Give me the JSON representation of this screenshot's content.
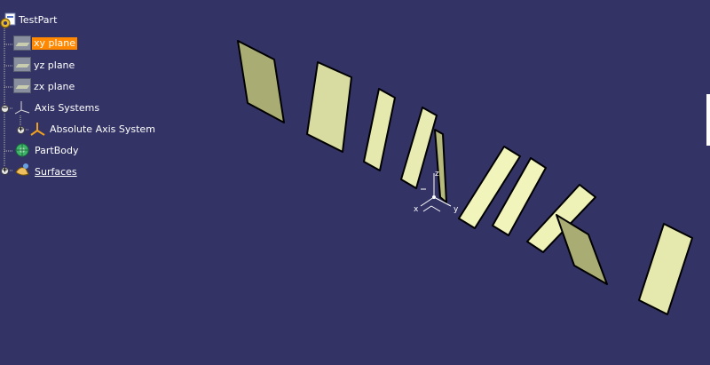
{
  "tree": {
    "root": {
      "label": "TestPart",
      "icon": "part-document-icon"
    },
    "items": [
      {
        "label": "xy plane",
        "icon": "plane-icon",
        "selected": true
      },
      {
        "label": "yz plane",
        "icon": "plane-icon",
        "selected": false
      },
      {
        "label": "zx plane",
        "icon": "plane-icon",
        "selected": false
      },
      {
        "label": "Axis Systems",
        "icon": "axis-systems-icon",
        "expander": "−"
      },
      {
        "label": "Absolute Axis System",
        "icon": "axis-system-icon",
        "expander": "+"
      },
      {
        "label": "PartBody",
        "icon": "part-body-icon"
      },
      {
        "label": "Surfaces",
        "icon": "surfaces-icon",
        "expander": "+"
      }
    ]
  },
  "compass": {
    "x_label": "x",
    "y_label": "y",
    "z_label": "z"
  },
  "colors": {
    "background": "#333366",
    "surface_light": "#eff2b7",
    "surface_dark": "#a9ad73",
    "selection": "#ff8800",
    "tree_text": "#ffffff"
  }
}
